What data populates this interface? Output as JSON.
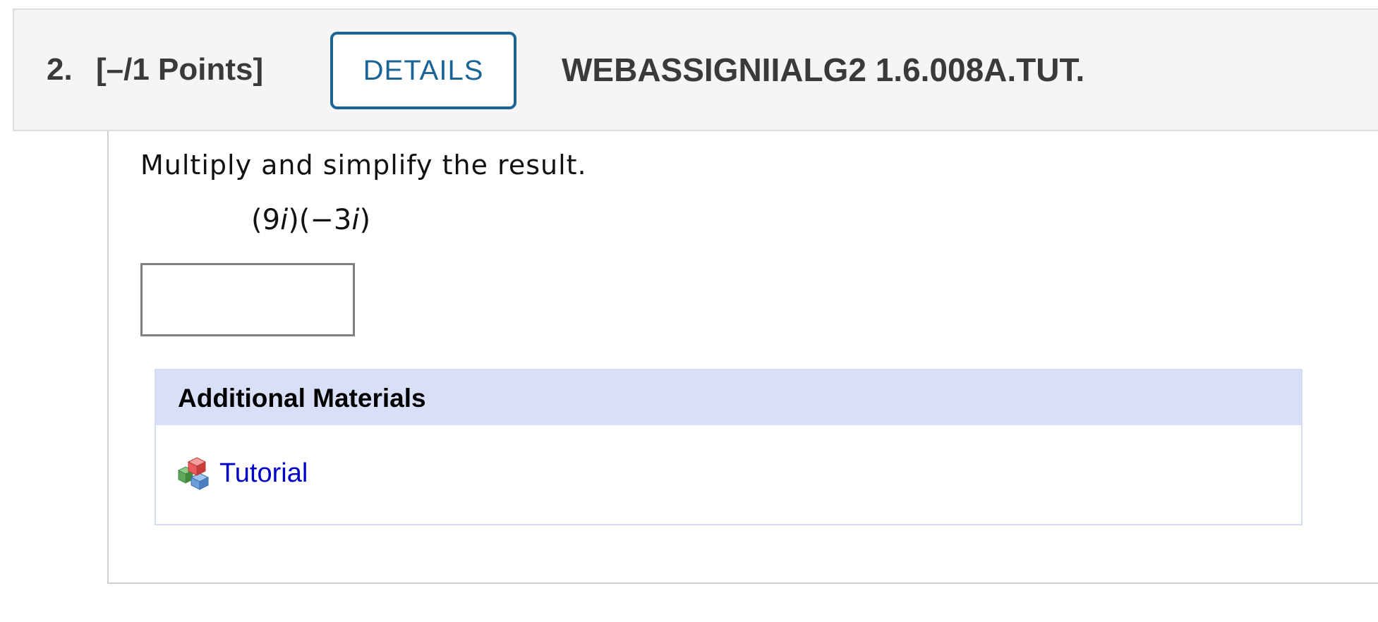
{
  "question": {
    "number": "2.",
    "points": "[–/1 Points]",
    "details_label": "DETAILS",
    "code": "WEBASSIGNIIALG2 1.6.008A.TUT."
  },
  "body": {
    "prompt": "Multiply and simplify the result.",
    "expression": {
      "open1": "(9",
      "var1": "i",
      "mid": ")(−3",
      "var2": "i",
      "close": ")"
    },
    "answer_value": ""
  },
  "materials": {
    "heading": "Additional Materials",
    "items": [
      {
        "label": "Tutorial",
        "icon": "cubes-icon"
      }
    ]
  },
  "colors": {
    "accent": "#1a6496",
    "link": "#0000c8",
    "materials_header_bg": "#d8dff6",
    "header_bg": "#f5f5f5"
  }
}
